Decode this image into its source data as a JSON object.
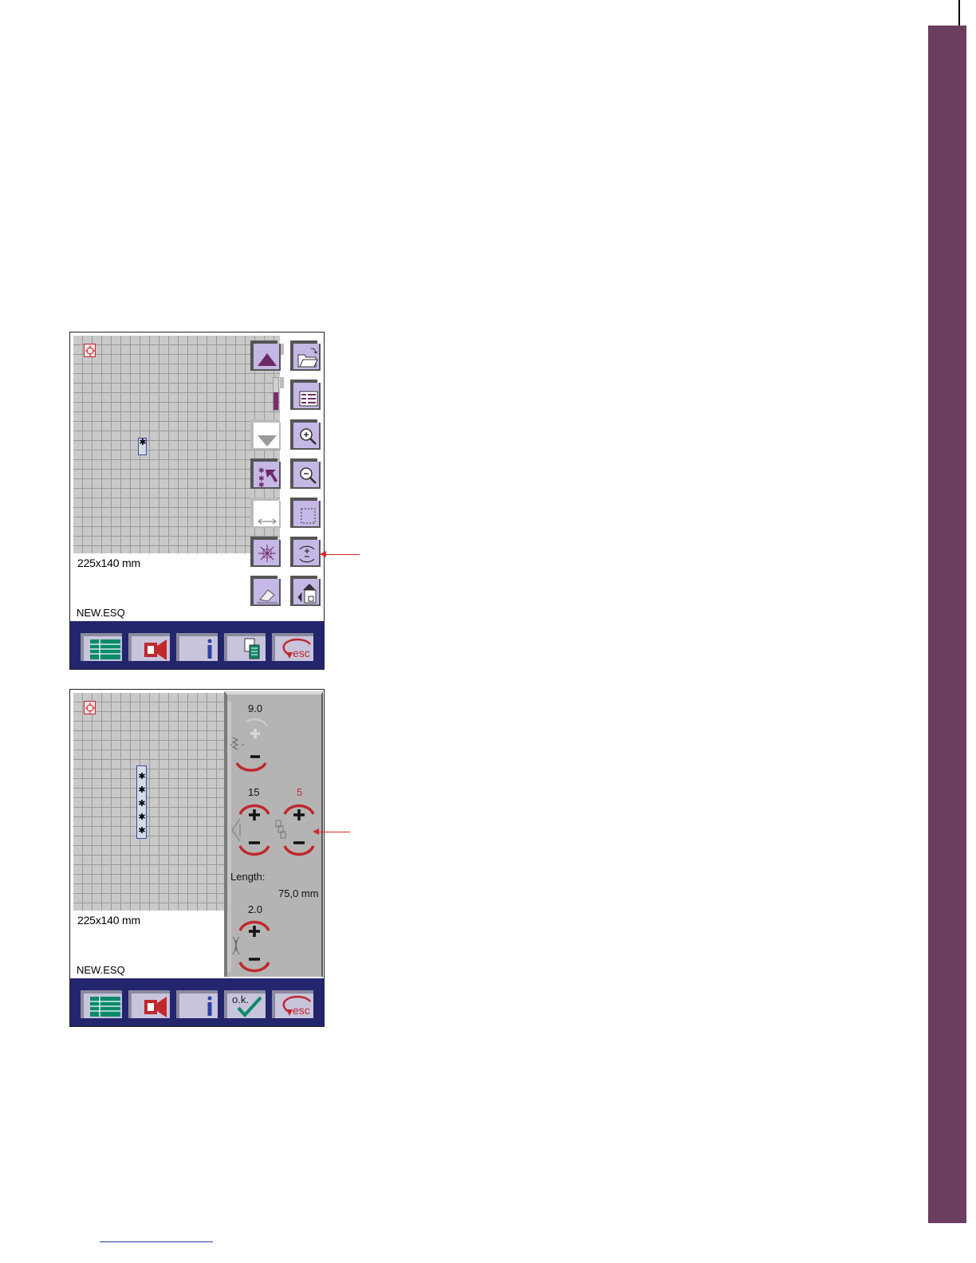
{
  "screen_top": {
    "hoop_size": "225x140 mm",
    "file_name": "NEW.ESQ",
    "stitch_marks": "✱",
    "slider_level": 0.55,
    "tools_left": [
      "move-up-icon",
      "slider",
      "move-down-icon",
      "select-stitch-icon",
      "stretch-icon",
      "explode-icon",
      "eraser-icon"
    ],
    "tools_right": [
      "open-folder-icon",
      "list-icon",
      "zoom-in-icon",
      "zoom-out-icon",
      "select-box-icon",
      "adjust-icon",
      "hoop-icon"
    ],
    "bottom_bar": [
      "menu-icon",
      "camera-icon",
      "info-icon",
      "copy-icon",
      "esc-icon"
    ],
    "esc_label": "esc"
  },
  "screen_bottom": {
    "hoop_size": "225x140 mm",
    "file_name": "NEW.ESQ",
    "stitch_marks": "✱✱✱✱✱",
    "width_value": "9.0",
    "density_value": "15",
    "repeat_value": "5",
    "length_label": "Length:",
    "length_value": "75,0 mm",
    "spacing_value": "2.0",
    "bottom_bar": [
      "menu-icon",
      "camera-icon",
      "info-icon",
      "ok-icon",
      "esc-icon"
    ],
    "ok_label": "o.k.",
    "esc_label": "esc"
  },
  "colors": {
    "accent_purple": "#6b3d5f",
    "button_lavender": "#c5b8e6",
    "bar_navy": "#23256d",
    "dial_red": "#c0282d",
    "callout_red": "#d12b2b"
  }
}
